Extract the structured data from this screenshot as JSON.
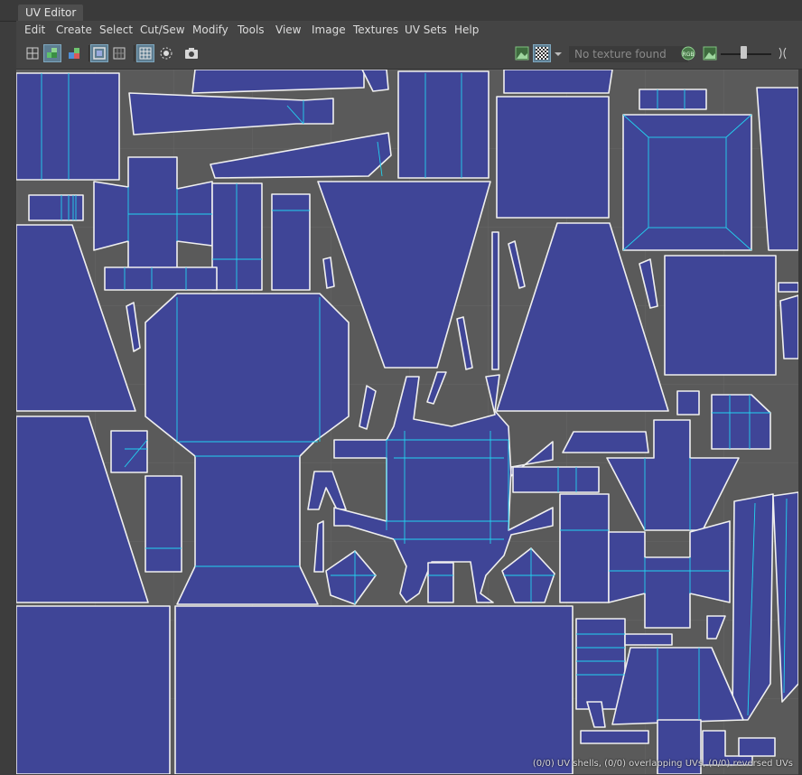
{
  "window": {
    "title": "UV Editor"
  },
  "menu": {
    "items": [
      "Edit",
      "Create",
      "Select",
      "Cut/Sew",
      "Modify",
      "Tools",
      "View",
      "Image",
      "Textures",
      "UV Sets",
      "Help"
    ]
  },
  "toolbar": {
    "left_icons": [
      "uv-shell-select-icon",
      "uv-shaded-icon",
      "uv-distortion-icon",
      "uv-border-icon",
      "uv-grid-toggle-icon",
      "checker-grid-icon",
      "pivot-icon",
      "snapshot-icon"
    ],
    "right_icons": [
      "image-display-icon",
      "checker-display-icon",
      "dropdown-arrow-icon",
      "rgb-channels-icon",
      "alpha-channel-icon",
      "exposure-icon"
    ],
    "texture_field_placeholder": "No texture found",
    "exposure_level": 0.45
  },
  "status": {
    "text": "(0/0) UV shells, (0/0) overlapping UVs, (0/0) reversed UVs"
  },
  "colors": {
    "uv_fill": "#3f4597",
    "uv_border": "#f0f0f0",
    "uv_seam": "#22d3f0",
    "grid_bg": "#5a5a5a",
    "grid_line": "#6a6a6a",
    "active_button": "#5d7d91"
  }
}
